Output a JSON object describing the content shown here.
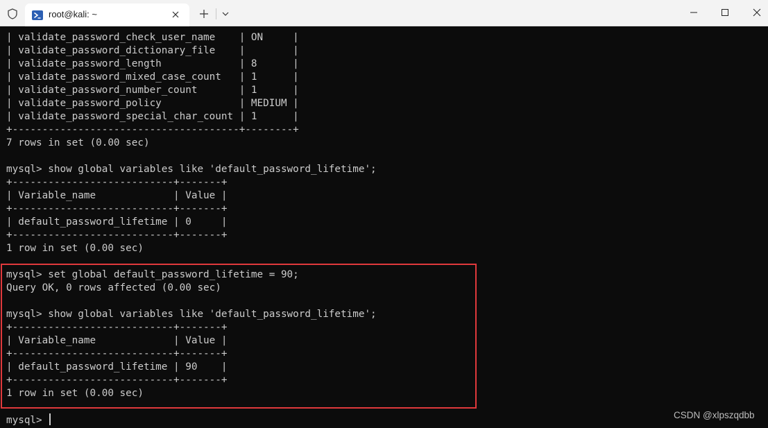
{
  "window": {
    "tab_title": "root@kali: ~",
    "icons": {
      "shield": "shield-icon",
      "tab": "powershell-icon",
      "close_tab": "close-icon",
      "new_tab": "plus-icon",
      "dropdown": "chevron-down-icon",
      "minimize": "minimize-icon",
      "maximize": "maximize-icon",
      "close_window": "close-icon"
    }
  },
  "terminal": {
    "lines": [
      "| validate_password_check_user_name    | ON     |",
      "| validate_password_dictionary_file    |        |",
      "| validate_password_length             | 8      |",
      "| validate_password_mixed_case_count   | 1      |",
      "| validate_password_number_count       | 1      |",
      "| validate_password_policy             | MEDIUM |",
      "| validate_password_special_char_count | 1      |",
      "+--------------------------------------+--------+",
      "7 rows in set (0.00 sec)",
      "",
      "mysql> show global variables like 'default_password_lifetime';",
      "+---------------------------+-------+",
      "| Variable_name             | Value |",
      "+---------------------------+-------+",
      "| default_password_lifetime | 0     |",
      "+---------------------------+-------+",
      "1 row in set (0.00 sec)",
      "",
      "mysql> set global default_password_lifetime = 90;",
      "Query OK, 0 rows affected (0.00 sec)",
      "",
      "mysql> show global variables like 'default_password_lifetime';",
      "+---------------------------+-------+",
      "| Variable_name             | Value |",
      "+---------------------------+-------+",
      "| default_password_lifetime | 90    |",
      "+---------------------------+-------+",
      "1 row in set (0.00 sec)",
      ""
    ],
    "prompt": "mysql> ",
    "highlight_color": "#e0393c",
    "foreground_color": "#cccccc",
    "background_color": "#0c0c0c"
  },
  "watermark": "CSDN @xlpszqdbb"
}
